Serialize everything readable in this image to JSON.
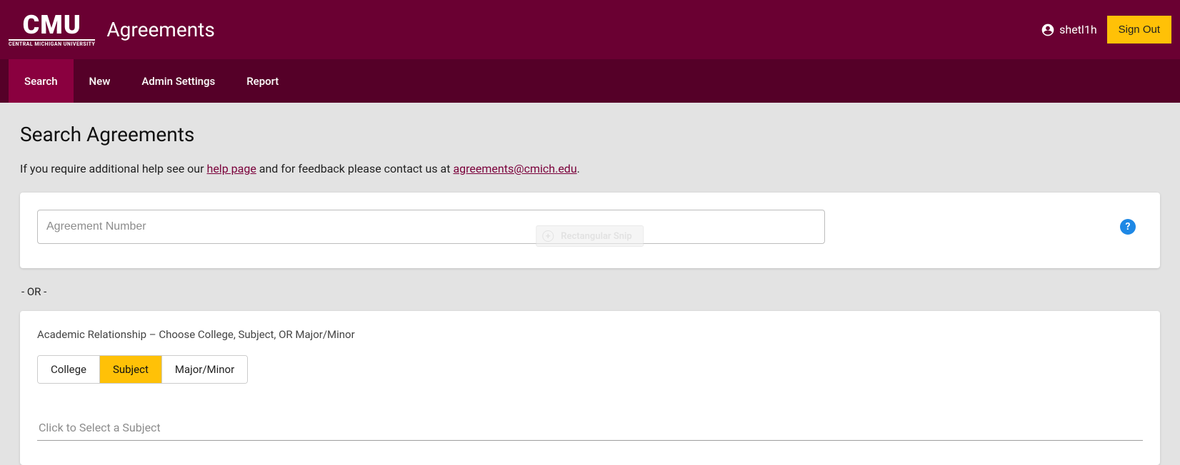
{
  "brand": {
    "main": "CMU",
    "sub": "CENTRAL MICHIGAN UNIVERSITY",
    "app_title": "Agreements"
  },
  "user": {
    "name": "shetl1h",
    "signout": "Sign Out"
  },
  "nav": {
    "items": [
      {
        "label": "Search",
        "active": true
      },
      {
        "label": "New",
        "active": false
      },
      {
        "label": "Admin Settings",
        "active": false
      },
      {
        "label": "Report",
        "active": false
      }
    ]
  },
  "page": {
    "title": "Search Agreements",
    "help_pre": "If you require additional help see our ",
    "help_link_text": "help page",
    "help_mid": " and for feedback please contact us at ",
    "help_email": "agreements@cmich.edu",
    "help_post": "."
  },
  "search": {
    "placeholder": "Agreement Number",
    "help_icon_label": "?"
  },
  "separator": "- OR -",
  "relationship": {
    "label": "Academic Relationship – Choose College, Subject, OR Major/Minor",
    "tabs": [
      {
        "label": "College",
        "active": false
      },
      {
        "label": "Subject",
        "active": true
      },
      {
        "label": "Major/Minor",
        "active": false
      }
    ],
    "subject_placeholder": "Click to Select a Subject"
  },
  "overlay": {
    "label": "Rectangular Snip"
  }
}
